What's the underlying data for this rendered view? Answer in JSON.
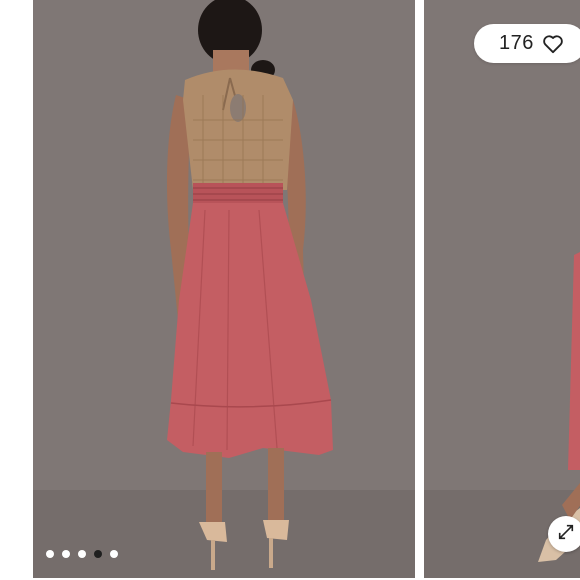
{
  "favorites": {
    "count": "176",
    "icon": "heart-outline-icon"
  },
  "carousel": {
    "total_slides": 5,
    "active_index": 3,
    "expand_icon": "expand-arrows-icon"
  },
  "colors": {
    "backdrop": "#7d7573",
    "skirt": "#c45e63",
    "top": "#b08c6a",
    "active_dot": "#1f1f1f"
  }
}
